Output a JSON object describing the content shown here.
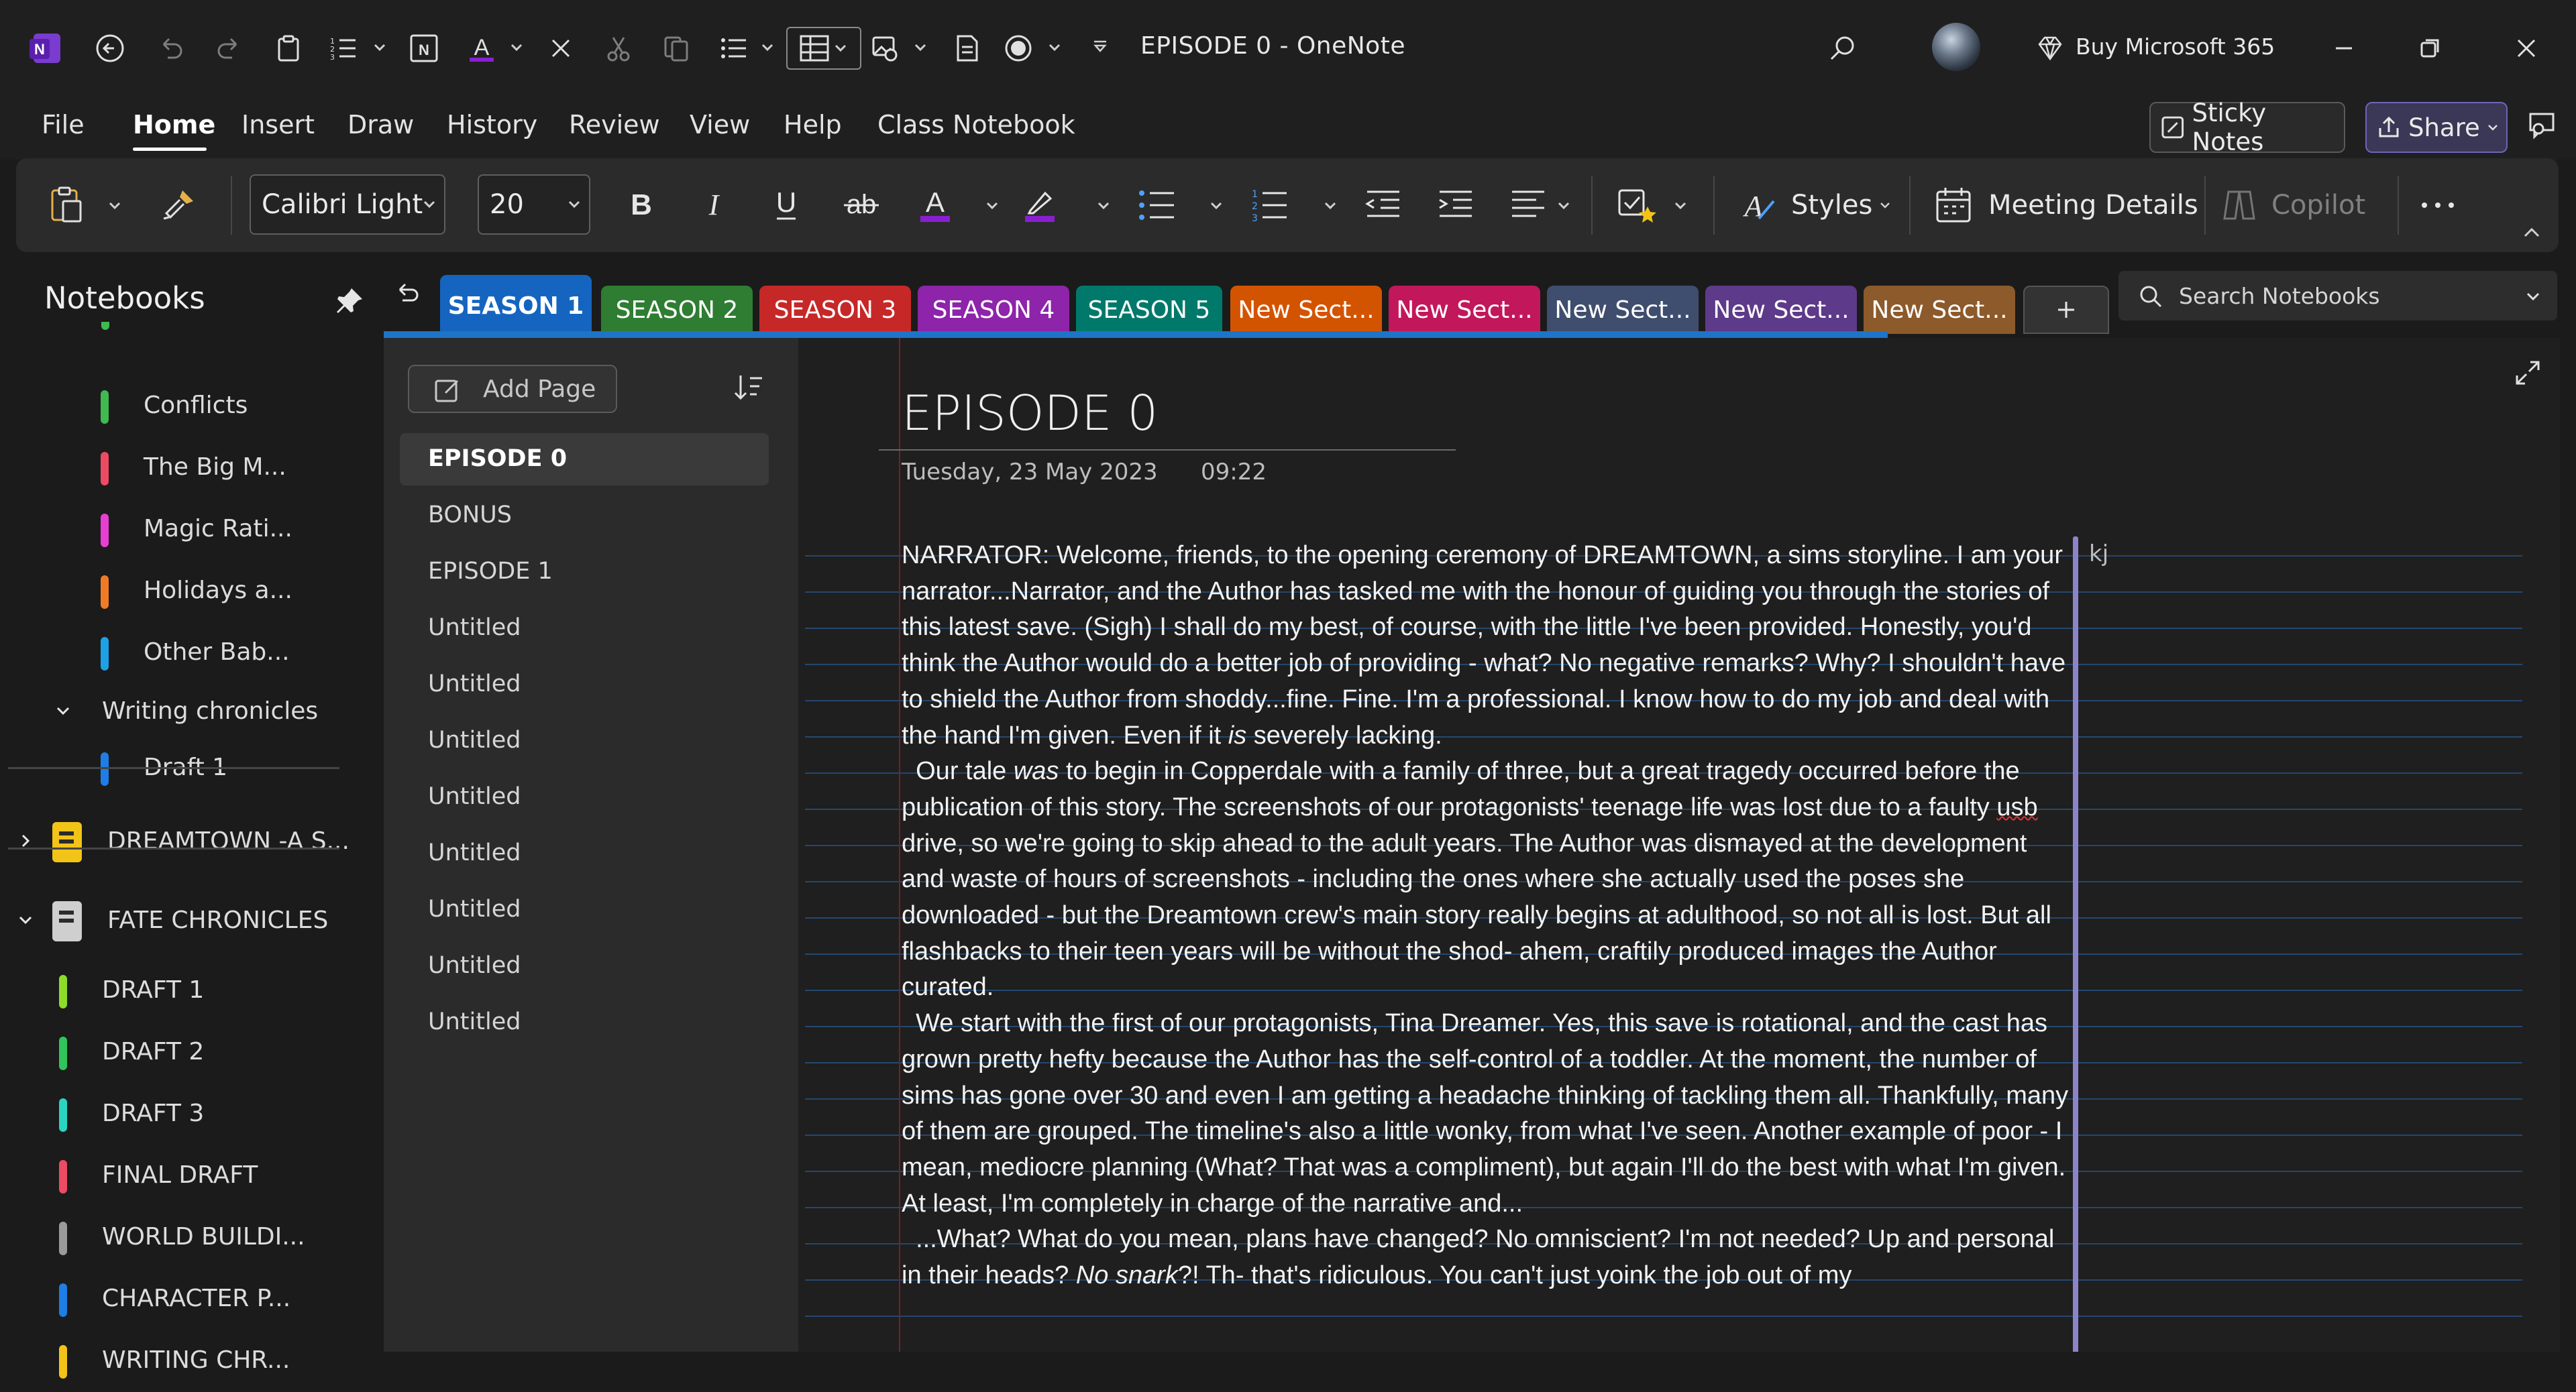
{
  "window": {
    "title": "EPISODE 0  -  OneNote",
    "buy_label": "Buy Microsoft 365"
  },
  "menu": {
    "items": [
      "File",
      "Home",
      "Insert",
      "Draw",
      "History",
      "Review",
      "View",
      "Help",
      "Class Notebook"
    ],
    "active": "Home",
    "sticky_notes": "Sticky Notes",
    "share": "Share"
  },
  "ribbon": {
    "font_family_value": "Calibri Light",
    "font_size_value": "20",
    "styles_label": "Styles",
    "meeting_label": "Meeting Details",
    "copilot_label": "Copilot",
    "font_color": "#8a1fd0",
    "highlight_color": "#8a1fd0"
  },
  "notebooks": {
    "title": "Notebooks",
    "rows": [
      {
        "label": "Conflicts",
        "color": "#3fb950",
        "indent": 2
      },
      {
        "label": "The Big M...",
        "color": "#ec4b63",
        "indent": 2
      },
      {
        "label": "Magic Rati...",
        "color": "#e83fd3",
        "indent": 2
      },
      {
        "label": "Holidays a...",
        "color": "#f07b26",
        "indent": 2
      },
      {
        "label": "Other Bab...",
        "color": "#1ea0e6",
        "indent": 2
      },
      {
        "label": "Writing chronicles",
        "color": "",
        "indent": 1,
        "group": true
      },
      {
        "label": "Draft 1",
        "color": "#1e7ee6",
        "indent": 2
      },
      {
        "label": "DREAMTOWN -A S...",
        "color": "#f2c418",
        "indent": 0,
        "notebook": true,
        "expanded": false
      },
      {
        "label": "FATE CHRONICLES",
        "color": "#cfcfcf",
        "indent": 0,
        "notebook": true,
        "expanded": true
      },
      {
        "label": "DRAFT 1",
        "color": "#8ddc2a",
        "indent": 1
      },
      {
        "label": "DRAFT 2",
        "color": "#30c45a",
        "indent": 1
      },
      {
        "label": "DRAFT 3",
        "color": "#2bd3c1",
        "indent": 1
      },
      {
        "label": "FINAL DRAFT",
        "color": "#ec4b63",
        "indent": 1
      },
      {
        "label": "WORLD BUILDI...",
        "color": "#9a9a9a",
        "indent": 1
      },
      {
        "label": "CHARACTER P...",
        "color": "#1e7ee6",
        "indent": 1
      },
      {
        "label": "WRITING CHR...",
        "color": "#f2c418",
        "indent": 1
      }
    ]
  },
  "sections": [
    {
      "label": "SEASON 1",
      "color": "#1565c0",
      "active": true
    },
    {
      "label": "SEASON 2",
      "color": "#2e7d32"
    },
    {
      "label": "SEASON 3",
      "color": "#c62828"
    },
    {
      "label": "SEASON 4",
      "color": "#8e24aa"
    },
    {
      "label": "SEASON 5",
      "color": "#00796b"
    },
    {
      "label": "New Sect...",
      "color": "#d35400"
    },
    {
      "label": "New Sect...",
      "color": "#c2185b"
    },
    {
      "label": "New Sect...",
      "color": "#3f4e6e"
    },
    {
      "label": "New Sect...",
      "color": "#5e3a8a"
    },
    {
      "label": "New Sect...",
      "color": "#8d5a2b"
    }
  ],
  "search": {
    "placeholder": "Search Notebooks"
  },
  "pages": {
    "add_label": "Add Page",
    "items": [
      "EPISODE 0",
      "BONUS",
      "EPISODE 1",
      "Untitled",
      "Untitled",
      "Untitled",
      "Untitled",
      "Untitled",
      "Untitled",
      "Untitled",
      "Untitled"
    ],
    "selected": 0
  },
  "note": {
    "title": "EPISODE 0",
    "date": "Tuesday, 23 May 2023",
    "time": "09:22",
    "stray": "kj",
    "p1": "NARRATOR: Welcome, friends, to the opening ceremony of DREAMTOWN, a sims storyline. I am your narrator...Narrator, and the Author has tasked me with the honour of guiding you through the stories of this latest save. (Sigh) I shall do my best, of course, with the little I've been provided. Honestly, you'd think the Author would do a better job of providing - what? No negative remarks? Why? I shouldn't have to shield the Author from shoddy...fine. Fine. I'm a professional. I know how to do my job and deal with the hand I'm given. Even if it ",
    "p1_em": "is",
    "p1_tail": " severely lacking.",
    "p2_a": "Our tale ",
    "p2_em": "was",
    "p2_b": " to begin in Copperdale with a family of three, but a great tragedy occurred before the publication of this story. The screenshots of our protagonists' teenage life was lost due to a faulty ",
    "p2_usb": "usb",
    "p2_c": " drive, so we're going to skip ahead to the adult years. The Author was dismayed at the development and waste of hours of screenshots - including the ones where she actually used the poses she downloaded - but the Dreamtown crew's main story really begins at adulthood, so not all is lost. But all flashbacks to their teen years will be without the shod- ahem, craftily produced images the Author curated.",
    "p3": "We start with the first of our protagonists, Tina Dreamer. Yes, this save is rotational, and the cast has grown pretty hefty because the Author has the self-control of a toddler. At the moment, the number of sims has gone over 30 and even I am getting a headache thinking of tackling them all. Thankfully, many of them are grouped. The timeline's also a little wonky, from what I've seen. Another example of poor - I mean, mediocre planning (What? That was a compliment), but again I'll do the best with what I'm given. At least, I'm completely in charge of the narrative and...",
    "p4_a": "...What? What do you mean, plans have changed? No omniscient? I'm not needed? Up and personal in their heads? ",
    "p4_em": "No snark",
    "p4_b": "?! Th- that's ridiculous. You can't just yoink the job out of my"
  }
}
